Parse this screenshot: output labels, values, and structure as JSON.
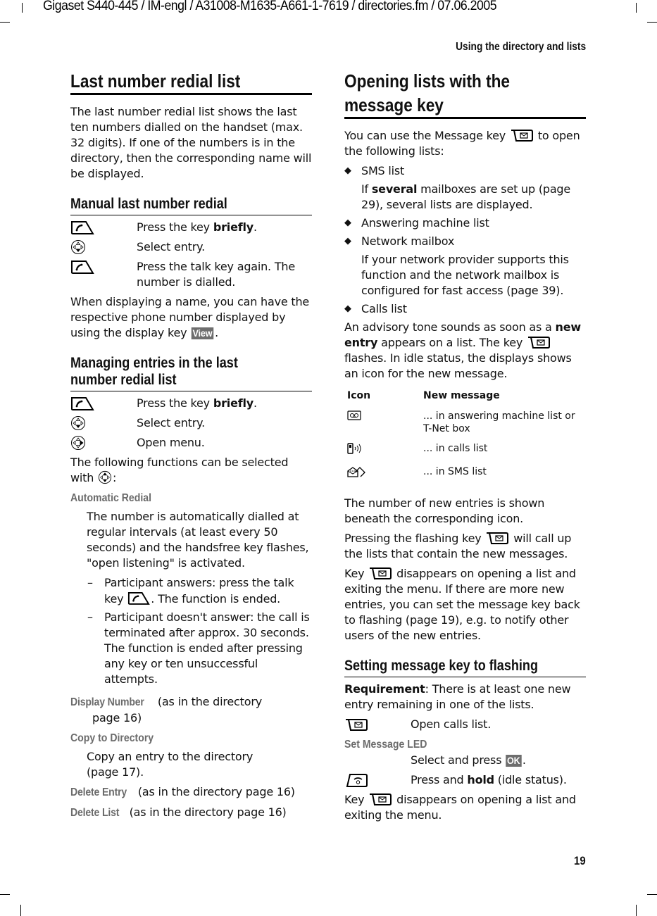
{
  "header": {
    "doc_info": "Gigaset S440-445 / IM-engl / A31008-M1635-A661-1-7619 / directories.fm / 07.06.2005",
    "running_title": "Using the directory and lists",
    "page_number": "19"
  },
  "left": {
    "title": "Last number redial list",
    "intro": "The last number redial list shows the last ten numbers dialled on the handset (max. 32 digits). If one of the numbers is in the directory, then the corresponding name will be displayed.",
    "manual": {
      "title": "Manual last number redial",
      "steps": [
        {
          "icon": "talk-key-icon",
          "pre": "Press the key ",
          "bold": "briefly",
          "post": "."
        },
        {
          "icon": "control-key-down-icon",
          "pre": "Select entry.",
          "bold": "",
          "post": ""
        },
        {
          "icon": "talk-key-icon",
          "pre": "Press the talk key again. The number is dialled.",
          "bold": "",
          "post": ""
        }
      ],
      "note_pre": "When displaying a name, you can have the respective phone number displayed by using the display key ",
      "note_softkey": "View",
      "note_post": "."
    },
    "managing": {
      "title_line1": "Managing entries in the last",
      "title_line2": "number redial list",
      "steps": [
        {
          "icon": "talk-key-icon",
          "pre": "Press the key ",
          "bold": "briefly",
          "post": "."
        },
        {
          "icon": "control-key-down-icon",
          "pre": "Select entry.",
          "bold": "",
          "post": ""
        },
        {
          "icon": "control-key-right-icon",
          "pre": "Open menu.",
          "bold": "",
          "post": ""
        }
      ],
      "functions_pre": "The following functions can be selected with ",
      "functions_post": ":",
      "auto_redial": {
        "label": "Automatic Redial",
        "desc": "The number is automatically dialled at regular intervals (at least every 50 seconds) and the handsfree key flashes, \"open listening\" is activated.",
        "dash1_pre": "Participant answers: press the talk key ",
        "dash1_post": ". The function is ended.",
        "dash2": "Participant doesn't answer: the call is terminated after approx. 30 seconds. The function is ended after pressing any key or ten unsuccessful attempts."
      },
      "display_number": {
        "label": "Display Number",
        "text1": " (as in the directory",
        "text2": "page 16)"
      },
      "copy": {
        "label": "Copy to Directory",
        "text": "Copy an entry to the directory (page 17)."
      },
      "delete_entry": {
        "label": "Delete Entry",
        "text": " (as in the directory page 16)"
      },
      "delete_list": {
        "label": "Delete List",
        "text": " (as in the directory page 16)"
      }
    }
  },
  "right": {
    "title_line1": "Opening lists with the",
    "title_line2": "message key",
    "intro_pre": "You can use the Message key ",
    "intro_post": " to open the following lists:",
    "bullets": [
      {
        "label": "SMS list",
        "sub_pre": "If ",
        "sub_bold": "several",
        "sub_post": " mailboxes are set up (page 29), several lists are displayed."
      },
      {
        "label": "Answering machine list",
        "sub_pre": "",
        "sub_bold": "",
        "sub_post": ""
      },
      {
        "label": "Network mailbox",
        "sub_pre": "If your network provider supports this function and the network mailbox is configured for fast access (page 39).",
        "sub_bold": "",
        "sub_post": ""
      },
      {
        "label": "Calls list",
        "sub_pre": "",
        "sub_bold": "",
        "sub_post": ""
      }
    ],
    "advisory_pre": "An advisory tone sounds as soon as a ",
    "advisory_bold": "new entry",
    "advisory_mid": " appears on a list. The key ",
    "advisory_post": " flashes. In idle status, the displays shows an icon for the new message.",
    "icon_table": {
      "headers": [
        "Icon",
        "New message"
      ],
      "rows": [
        {
          "icon": "answering-machine-icon",
          "text": "... in answering machine list or T-Net box"
        },
        {
          "icon": "missed-call-icon",
          "text": "... in calls list"
        },
        {
          "icon": "sms-envelope-icon",
          "text": "... in SMS list"
        }
      ]
    },
    "p_number": "The number of new entries is shown beneath the corresponding icon.",
    "p_pressing_pre": "Pressing the flashing key ",
    "p_pressing_post": " will call up the lists that contain the new messages.",
    "p_key_pre": "Key ",
    "p_key_post": " disappears on opening a list and exiting the menu. If there are more new entries, you can set the message key back to flashing (page 19), e.g. to notify other users of the new entries.",
    "setting": {
      "title": "Setting message key to flashing",
      "req_bold": "Requirement",
      "req_text": ": There is at least one new entry remaining in one of the lists.",
      "step1": "Open calls list.",
      "menu_label": "Set Message LED",
      "step2_pre": "Select and press ",
      "step2_softkey": "OK",
      "step2_post": ".",
      "step3_pre": "Press and ",
      "step3_bold": "hold",
      "step3_post": " (idle status).",
      "final_pre": "Key ",
      "final_post": " disappears on opening a list and exiting the menu."
    }
  }
}
